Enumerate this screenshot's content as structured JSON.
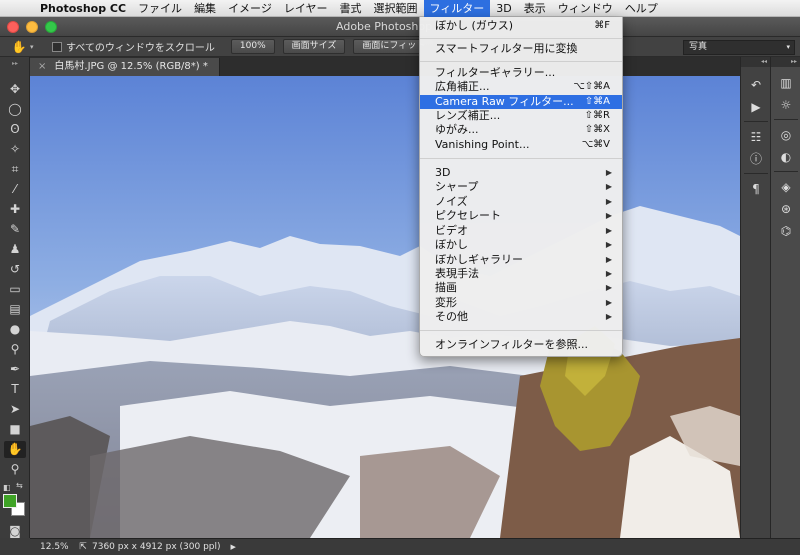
{
  "menubar": {
    "apple": "",
    "app_name": "Photoshop CC",
    "items": [
      "ファイル",
      "編集",
      "イメージ",
      "レイヤー",
      "書式",
      "選択範囲",
      "フィルター",
      "3D",
      "表示",
      "ウィンドウ",
      "ヘルプ"
    ]
  },
  "window": {
    "title": "Adobe Photoshop"
  },
  "options": {
    "hand_icon": "✋",
    "caret": "▾",
    "scroll_all_label": "すべてのウィンドウをスクロール",
    "btn_100": "100%",
    "btn_fit_screen": "画面サイズ",
    "btn_fill_screen": "画面にフィット",
    "workspace": "写真"
  },
  "document": {
    "tab_close": "×",
    "tab_label": "白馬村.JPG @ 12.5% (RGB/8*) *"
  },
  "status": {
    "zoom": "12.5%",
    "icon": "⇱",
    "info": "7360 px x 4912 px (300 ppl)",
    "arrow": "▶"
  },
  "colors": {
    "foreground": "#3fa326",
    "background": "#ffffff",
    "menu_highlight": "#2e6fe3"
  },
  "filter_menu": {
    "last_filter": {
      "label": "ぼかし (ガウス)",
      "shortcut": "⌘F"
    },
    "smart": {
      "label": "スマートフィルター用に変換"
    },
    "gallery": {
      "label": "フィルターギャラリー..."
    },
    "adaptive_wide": {
      "label": "広角補正...",
      "shortcut": "⌥⇧⌘A"
    },
    "camera_raw": {
      "label": "Camera Raw フィルター...",
      "shortcut": "⇧⌘A"
    },
    "lens": {
      "label": "レンズ補正...",
      "shortcut": "⇧⌘R"
    },
    "liquify": {
      "label": "ゆがみ...",
      "shortcut": "⇧⌘X"
    },
    "vanishing": {
      "label": "Vanishing Point...",
      "shortcut": "⌥⌘V"
    },
    "submenus": [
      "3D",
      "シャープ",
      "ノイズ",
      "ピクセレート",
      "ビデオ",
      "ぼかし",
      "ぼかしギャラリー",
      "表現手法",
      "描画",
      "変形",
      "その他"
    ],
    "submenu_arrow": "▶",
    "browse": {
      "label": "オンラインフィルターを参照..."
    }
  },
  "panel_icons": [
    "history-icon",
    "actions-play-icon",
    "properties-icon",
    "info-icon",
    "character-icon",
    "histogram-icon",
    "adjustments-icon",
    "styles-icon",
    "layers-icon",
    "channels-icon",
    "paths-icon"
  ]
}
